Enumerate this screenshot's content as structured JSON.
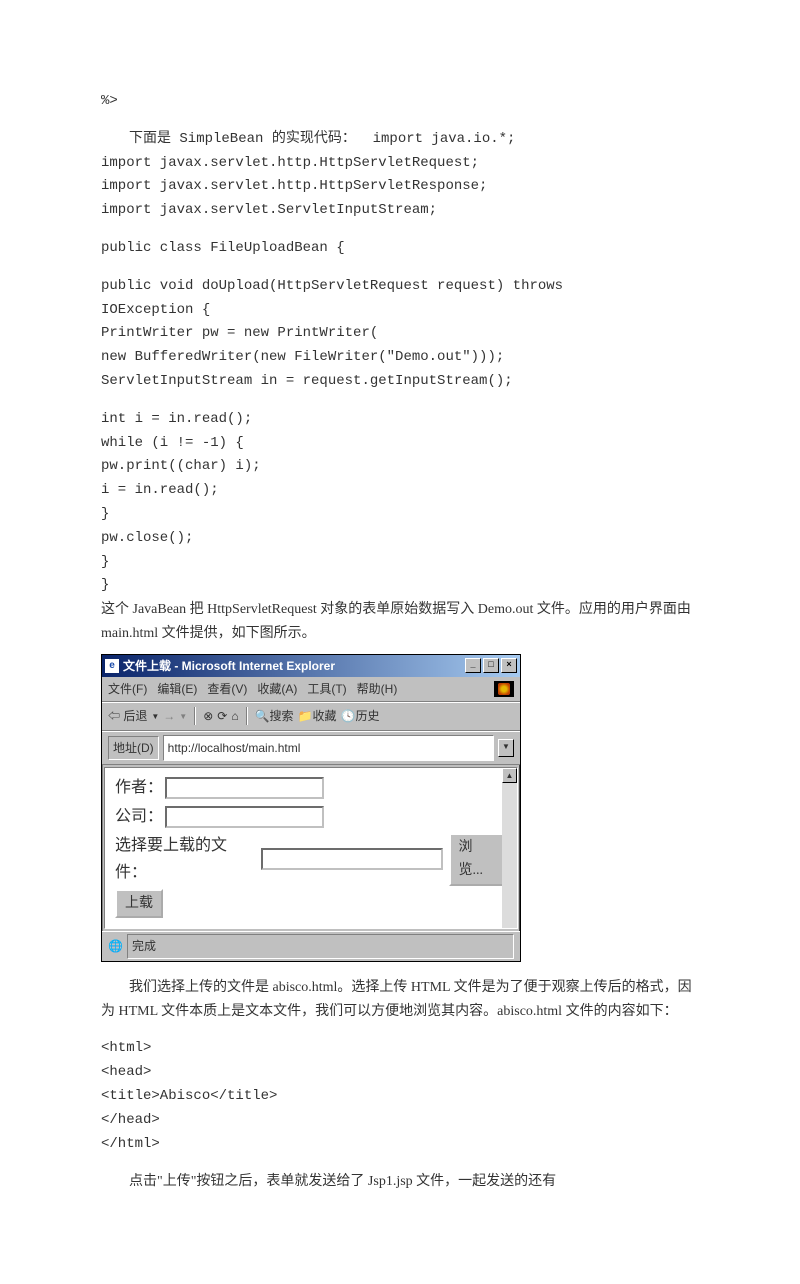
{
  "code1": {
    "l0": "%>",
    "intro": "　　下面是 SimpleBean 的实现代码：  import java.io.*;",
    "l1": "import javax.servlet.http.HttpServletRequest;",
    "l2": "import javax.servlet.http.HttpServletResponse;",
    "l3": "import javax.servlet.ServletInputStream;",
    "l4": "public class FileUploadBean {",
    "l5": "public void doUpload(HttpServletRequest request) throws",
    "l6": "IOException {",
    "l7": "PrintWriter pw = new PrintWriter(",
    "l8": "new BufferedWriter(new FileWriter(\"Demo.out\")));",
    "l9": "ServletInputStream in = request.getInputStream();",
    "l10": "int i = in.read();",
    "l11": "while (i != -1) {",
    "l12": "pw.print((char) i);",
    "l13": "i = in.read();",
    "l14": "}",
    "l15": "pw.close();",
    "l16": "}",
    "l17": "}"
  },
  "para1": "这个 JavaBean 把 HttpServletRequest 对象的表单原始数据写入 Demo.out 文件。应用的用户界面由 main.html 文件提供，如下图所示。",
  "ie": {
    "title": "文件上载 - Microsoft Internet Explorer",
    "menu": {
      "file": "文件(F)",
      "edit": "编辑(E)",
      "view": "查看(V)",
      "fav": "收藏(A)",
      "tools": "工具(T)",
      "help": "帮助(H)"
    },
    "toolbar": {
      "back": "后退",
      "search": "搜索",
      "favorites": "收藏",
      "history": "历史"
    },
    "address": {
      "label": "地址(D)",
      "url": "http://localhost/main.html"
    },
    "form": {
      "author": "作者：",
      "company": "公司：",
      "select": "选择要上载的文件：",
      "browse": "浏览...",
      "upload": "上载"
    },
    "status": "完成"
  },
  "para2": "　　我们选择上传的文件是 abisco.html。选择上传 HTML 文件是为了便于观察上传后的格式，因为 HTML 文件本质上是文本文件，我们可以方便地浏览其内容。abisco.html 文件的内容如下：",
  "code2": {
    "l0": "<html>",
    "l1": "<head>",
    "l2": "<title>Abisco</title>",
    "l3": "</head>",
    "l4": "</html>"
  },
  "para3": "　　点击\"上传\"按钮之后，表单就发送给了 Jsp1.jsp 文件，一起发送的还有"
}
